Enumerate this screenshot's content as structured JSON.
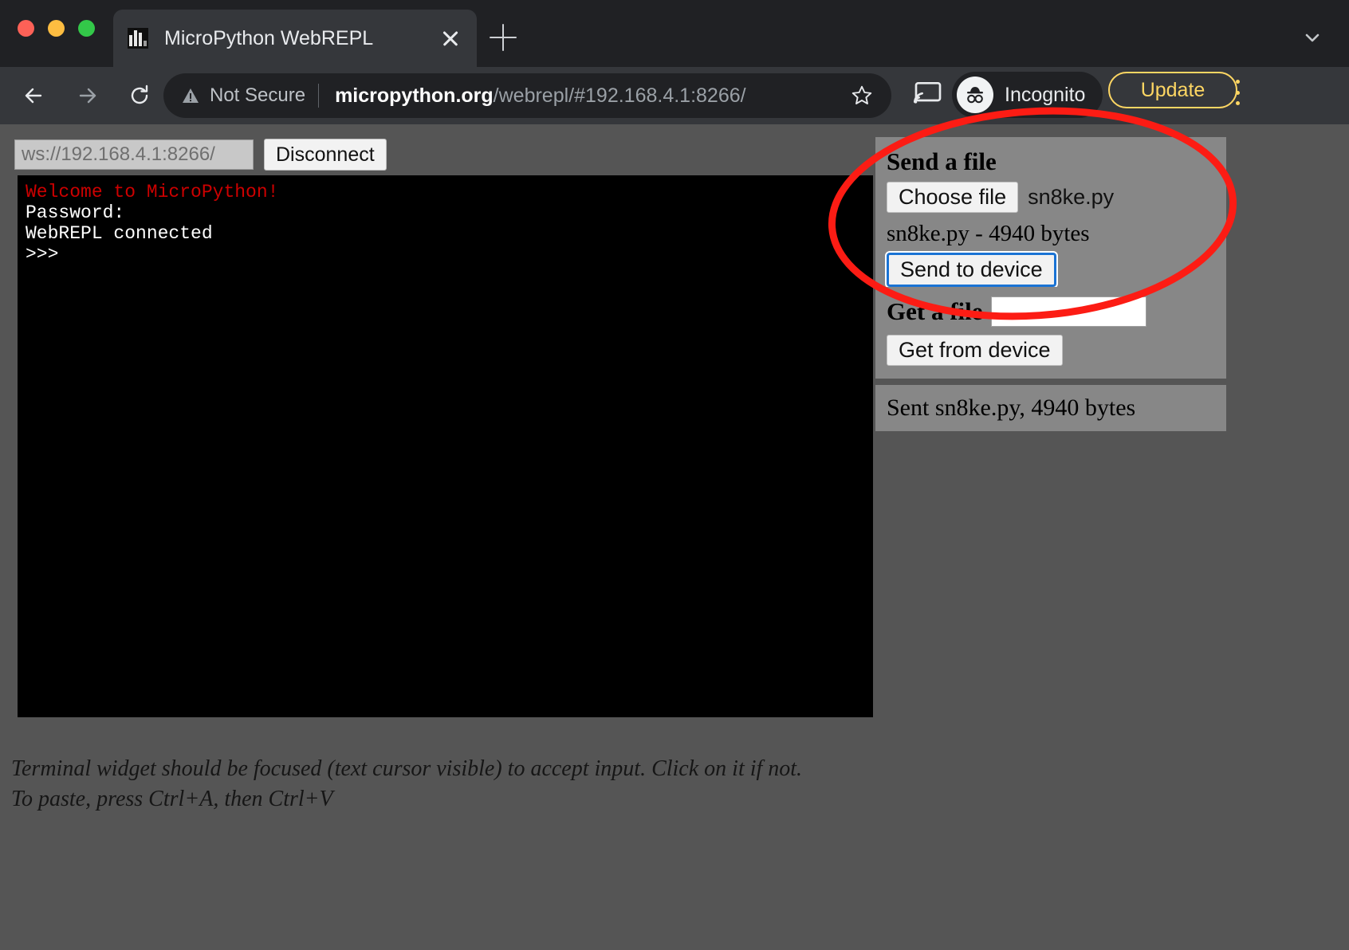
{
  "browser": {
    "tab": {
      "title": "MicroPython WebREPL",
      "favicon": "micropython-logo-icon",
      "close_icon": "close-icon"
    },
    "new_tab_icon": "plus-icon",
    "tabstrip_chevron_icon": "chevron-down-icon",
    "nav": {
      "back_icon": "arrow-left-icon",
      "forward_icon": "arrow-right-icon",
      "reload_icon": "reload-icon"
    },
    "omnibox": {
      "warning_icon": "warning-triangle-icon",
      "security_label": "Not Secure",
      "url_host": "micropython.org",
      "url_path": "/webrepl/#192.168.4.1:8266/",
      "bookmark_icon": "star-icon"
    },
    "cast_icon": "cast-icon",
    "incognito": {
      "label": "Incognito",
      "icon": "incognito-hat-glasses-icon"
    },
    "update_button": "Update",
    "menu_icon": "kebab-menu-icon",
    "colors": {
      "tabstrip_bg": "#202124",
      "toolbar_bg": "#35373b",
      "accent_yellow": "#fdd663"
    }
  },
  "page": {
    "connection": {
      "ws_url": "ws://192.168.4.1:8266/",
      "ws_placeholder": "ws://192.168.4.1:8266/",
      "disconnect_label": "Disconnect"
    },
    "terminal": {
      "lines": [
        {
          "text": "Welcome to MicroPython!",
          "color": "red"
        },
        {
          "text": "Password:",
          "color": "white"
        },
        {
          "text": "WebREPL connected",
          "color": "white"
        },
        {
          "text": ">>>",
          "color": "white"
        }
      ],
      "welcome": "Welcome to MicroPython!",
      "password": "Password:",
      "connected": "WebREPL connected",
      "prompt": ">>>"
    },
    "hint": {
      "line1": "Terminal widget should be focused (text cursor visible) to accept input. Click on it if not.",
      "line2": "To paste, press Ctrl+A, then Ctrl+V"
    },
    "send_panel": {
      "heading": "Send a file",
      "choose_file_label": "Choose file",
      "chosen_file": "sn8ke.py",
      "file_info": "sn8ke.py - 4940 bytes",
      "send_label": "Send to device"
    },
    "get_panel": {
      "heading": "Get a file",
      "filename_value": "",
      "filename_placeholder": "",
      "get_label": "Get from device"
    },
    "status_panel": {
      "message": "Sent sn8ke.py, 4940 bytes"
    },
    "colors": {
      "page_bg": "#555555",
      "panel_bg": "#878787",
      "terminal_bg": "#000000",
      "terminal_red": "#cc0000",
      "focus_blue": "#1a73d4"
    }
  },
  "annotation": {
    "shape": "red-ellipse-highlight",
    "color": "#fc1c14"
  }
}
